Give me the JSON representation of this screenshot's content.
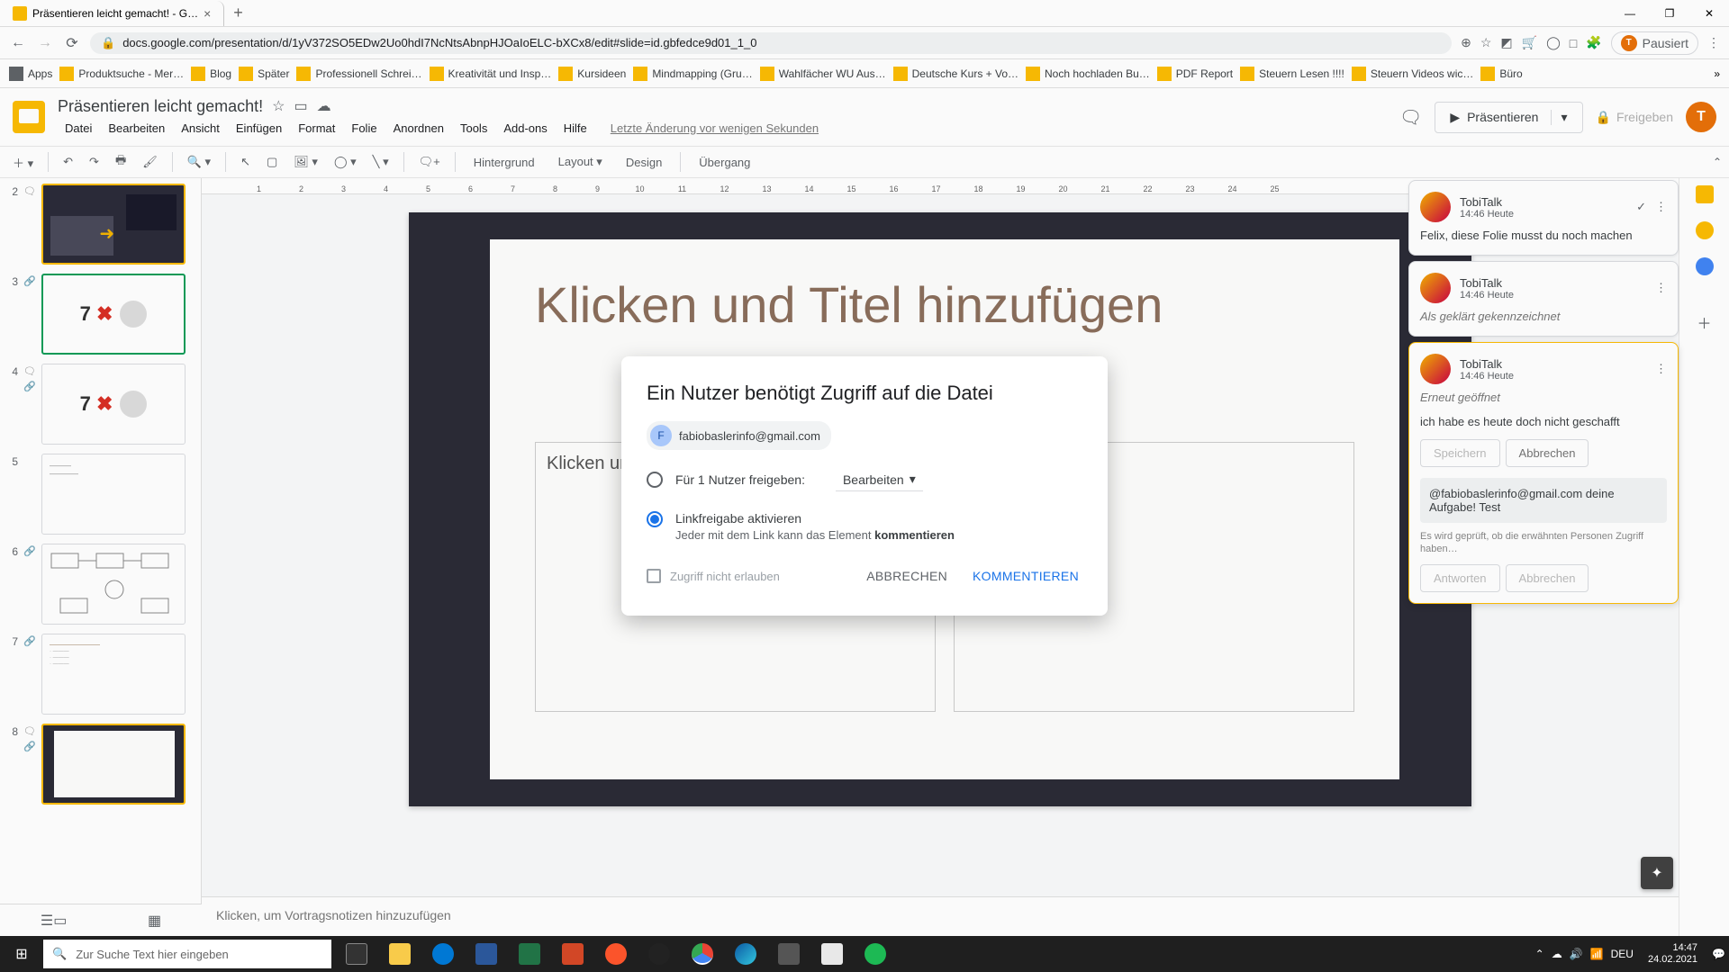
{
  "browser": {
    "tab_title": "Präsentieren leicht gemacht! - G…",
    "url": "docs.google.com/presentation/d/1yV372SO5EDw2Uo0hdI7NcNtsAbnpHJOaIoELC-bXCx8/edit#slide=id.gbfedce9d01_1_0",
    "paused_label": "Pausiert",
    "bookmarks": [
      "Apps",
      "Produktsuche - Mer…",
      "Blog",
      "Später",
      "Professionell Schrei…",
      "Kreativität und Insp…",
      "Kursideen",
      "Mindmapping  (Gru…",
      "Wahlfächer WU Aus…",
      "Deutsche Kurs + Vo…",
      "Noch hochladen Bu…",
      "PDF Report",
      "Steuern Lesen !!!!",
      "Steuern Videos wic…",
      "Büro"
    ]
  },
  "doc": {
    "title": "Präsentieren leicht gemacht!",
    "menus": [
      "Datei",
      "Bearbeiten",
      "Ansicht",
      "Einfügen",
      "Format",
      "Folie",
      "Anordnen",
      "Tools",
      "Add-ons",
      "Hilfe"
    ],
    "last_edit": "Letzte Änderung vor wenigen Sekunden",
    "present": "Präsentieren",
    "share": "Freigeben"
  },
  "toolbar": {
    "background": "Hintergrund",
    "layout": "Layout",
    "design": "Design",
    "transition": "Übergang"
  },
  "ruler_h": [
    "1",
    "2",
    "3",
    "4",
    "5",
    "6",
    "7",
    "8",
    "9",
    "10",
    "11",
    "12",
    "13",
    "14",
    "15",
    "16",
    "17",
    "18",
    "19",
    "20",
    "21",
    "22",
    "23",
    "24",
    "25"
  ],
  "slides": {
    "nums": [
      "2",
      "3",
      "4",
      "5",
      "6",
      "7",
      "8"
    ],
    "seven_x": "7",
    "x": "✖"
  },
  "canvas": {
    "title_placeholder": "Klicken und Titel hinzufügen",
    "text_placeholder": "Klicken und Text hinzufügen"
  },
  "notes": {
    "placeholder": "Klicken, um Vortragsnotizen hinzuzufügen"
  },
  "comments": {
    "threads": [
      {
        "name": "TobiTalk",
        "time": "14:46 Heute",
        "text": "Felix, diese Folie musst du noch machen",
        "show_check": true
      },
      {
        "name": "TobiTalk",
        "time": "14:46 Heute",
        "text": "Als geklärt gekennzeichnet",
        "italic": true
      },
      {
        "name": "TobiTalk",
        "time": "14:46 Heute",
        "text": "Erneut geöffnet",
        "italic": true
      }
    ],
    "reopened_extra": "ich habe es heute doch nicht geschafft",
    "save": "Speichern",
    "cancel": "Abbrechen",
    "mention": "@fabiobaslerinfo@gmail.com deine Aufgabe! Test",
    "access_note": "Es wird geprüft, ob die erwähnten Personen Zugriff haben…",
    "reply": "Antworten",
    "cancel2": "Abbrechen"
  },
  "dialog": {
    "title": "Ein Nutzer benötigt Zugriff auf die Datei",
    "user_email": "fabiobaslerinfo@gmail.com",
    "user_initial": "F",
    "opt1_label": "Für 1 Nutzer freigeben:",
    "opt1_perm": "Bearbeiten",
    "opt2_label": "Linkfreigabe aktivieren",
    "opt2_sub_a": "Jeder mit dem Link kann das Element ",
    "opt2_sub_b": "kommentieren",
    "deny_label": "Zugriff nicht erlauben",
    "cancel": "ABBRECHEN",
    "confirm": "KOMMENTIEREN"
  },
  "taskbar": {
    "search_placeholder": "Zur Suche Text hier eingeben",
    "lang": "DEU",
    "time": "14:47",
    "date": "24.02.2021"
  }
}
